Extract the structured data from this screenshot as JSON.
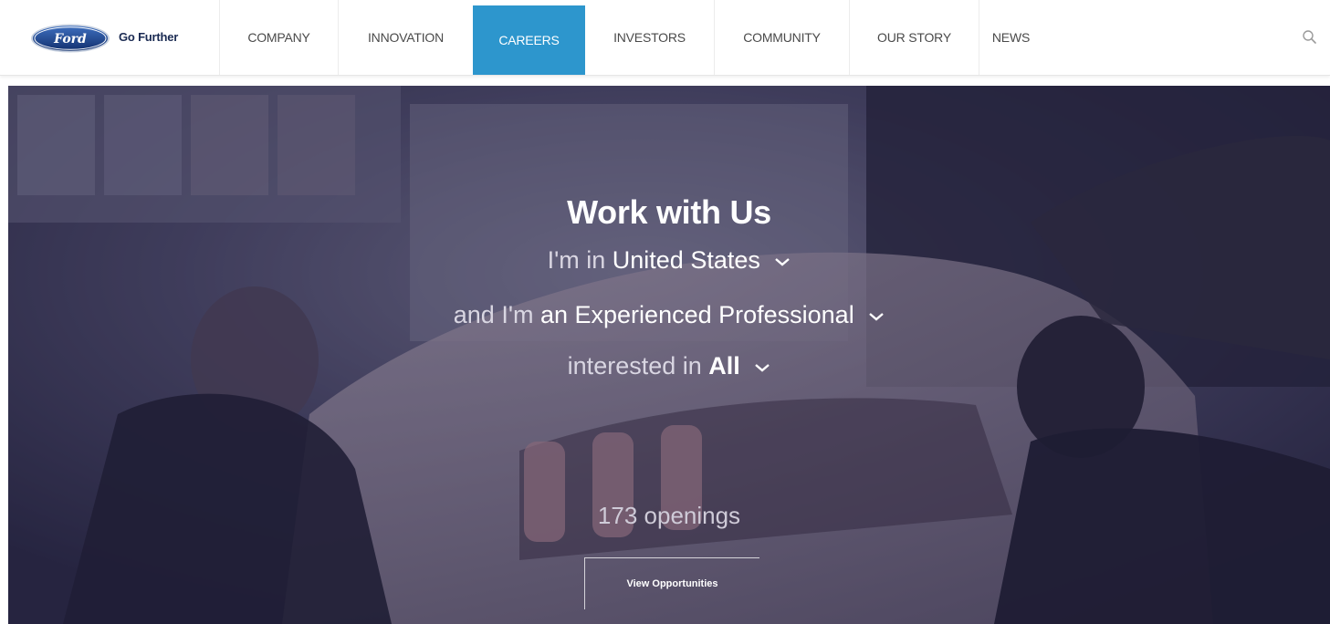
{
  "brand": {
    "logo_text": "Ford",
    "tagline": "Go Further"
  },
  "nav": {
    "items": [
      {
        "label": "COMPANY",
        "active": false
      },
      {
        "label": "INNOVATION",
        "active": false
      },
      {
        "label": "CAREERS",
        "active": true
      },
      {
        "label": "INVESTORS",
        "active": false
      },
      {
        "label": "COMMUNITY",
        "active": false
      },
      {
        "label": "OUR STORY",
        "active": false
      },
      {
        "label": "NEWS",
        "active": false
      }
    ],
    "search_icon": "search-icon"
  },
  "hero": {
    "title": "Work with Us",
    "location": {
      "prefix": "I'm in",
      "value": "United States"
    },
    "experience": {
      "prefix": "and I'm",
      "value": "an Experienced Professional"
    },
    "interest": {
      "prefix": "interested in",
      "value": "All"
    },
    "openings_text": "173 openings",
    "cta_label": "View Opportunities"
  },
  "colors": {
    "accent": "#2d96cd",
    "brand_navy": "#1a2a52",
    "hero_overlay": "#2d2c48"
  }
}
